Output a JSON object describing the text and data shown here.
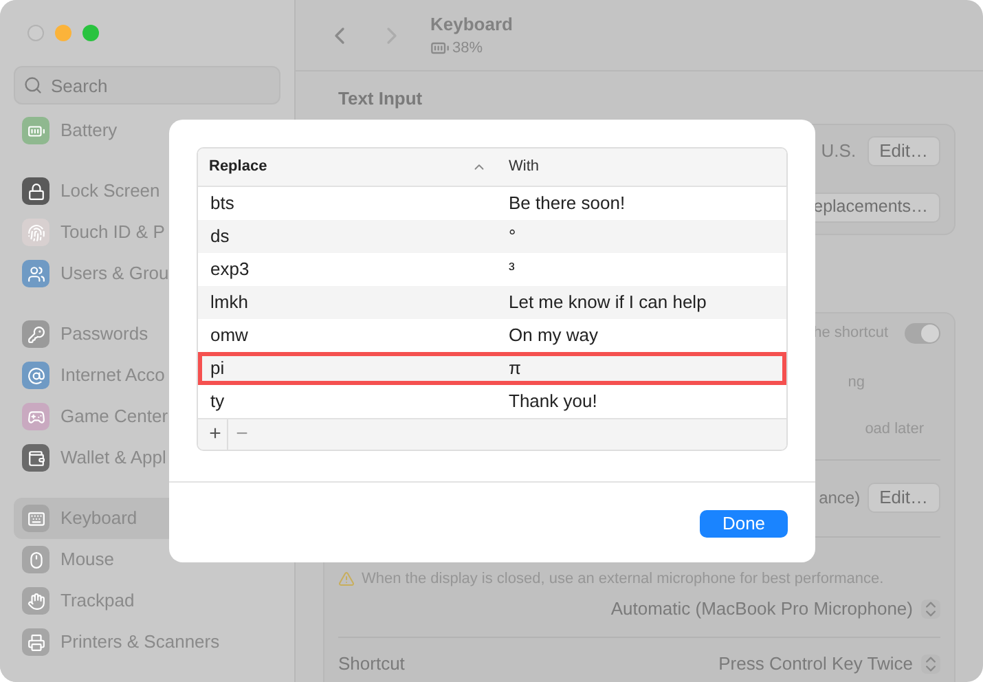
{
  "sidebar": {
    "search": {
      "placeholder": "Search"
    },
    "groups": [
      [
        {
          "label": "Battery",
          "selected": false
        }
      ],
      [
        {
          "label": "Lock Screen",
          "selected": false
        },
        {
          "label": "Touch ID & P",
          "selected": false
        },
        {
          "label": "Users & Grou",
          "selected": false
        }
      ],
      [
        {
          "label": "Passwords",
          "selected": false
        },
        {
          "label": "Internet Acco",
          "selected": false
        },
        {
          "label": "Game Center",
          "selected": false
        },
        {
          "label": "Wallet & Appl",
          "selected": false
        }
      ],
      [
        {
          "label": "Keyboard",
          "selected": true
        },
        {
          "label": "Mouse",
          "selected": false
        },
        {
          "label": "Trackpad",
          "selected": false
        },
        {
          "label": "Printers & Scanners",
          "selected": false
        }
      ]
    ]
  },
  "header": {
    "title": "Keyboard",
    "battery": "38%"
  },
  "content": {
    "section_title": "Text Input",
    "input_sources": {
      "value": "U.S.",
      "button": "Edit…"
    },
    "replacements_button": "eplacements…",
    "dictation": {
      "toggle_label": "he shortcut",
      "on": true,
      "line_2": "ng",
      "line_3": "oad later",
      "language": "ance)",
      "language_button": "Edit…",
      "warning": "When the display is closed, use an external microphone for best performance.",
      "microphone": "Automatic (MacBook Pro Microphone)",
      "shortcut_label": "Shortcut",
      "shortcut": "Press Control Key Twice"
    }
  },
  "dialog": {
    "columns": [
      {
        "label": "Replace",
        "sorted": true
      },
      {
        "label": "With",
        "sorted": false
      }
    ],
    "rows": [
      {
        "replace": "bts",
        "with": "Be there soon!",
        "highlighted": false
      },
      {
        "replace": "ds",
        "with": "°",
        "highlighted": false
      },
      {
        "replace": "exp3",
        "with": "³",
        "highlighted": false
      },
      {
        "replace": "lmkh",
        "with": "Let me know if I can help",
        "highlighted": false
      },
      {
        "replace": "omw",
        "with": "On my way",
        "highlighted": false
      },
      {
        "replace": "pi",
        "with": "π",
        "highlighted": true
      },
      {
        "replace": "ty",
        "with": "Thank you!",
        "highlighted": false
      }
    ],
    "add": "+",
    "remove": {
      "label": "−",
      "disabled": true
    },
    "done": "Done"
  }
}
